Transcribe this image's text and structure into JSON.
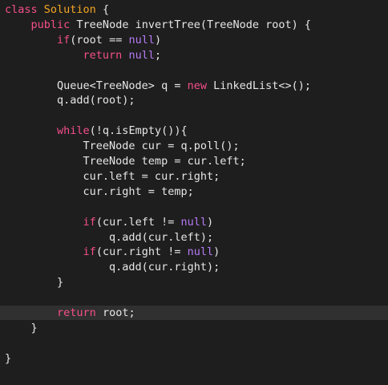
{
  "editor": {
    "colors": {
      "background": "#1e1e1e",
      "current_line": "#303030",
      "keyword": "#f44f8a",
      "class_name": "#f5a623",
      "text": "#e6e6e6",
      "null": "#b57af5"
    },
    "current_line_index": 20,
    "lines": [
      {
        "tokens": [
          {
            "t": "class ",
            "c": "kw"
          },
          {
            "t": "Solution",
            "c": "cls"
          },
          {
            "t": " {",
            "c": "plain"
          }
        ]
      },
      {
        "tokens": [
          {
            "t": "    ",
            "c": "plain"
          },
          {
            "t": "public",
            "c": "kw"
          },
          {
            "t": " TreeNode invertTree(TreeNode root) {",
            "c": "plain"
          }
        ]
      },
      {
        "tokens": [
          {
            "t": "        ",
            "c": "plain"
          },
          {
            "t": "if",
            "c": "kw"
          },
          {
            "t": "(root == ",
            "c": "plain"
          },
          {
            "t": "null",
            "c": "null"
          },
          {
            "t": ")",
            "c": "plain"
          }
        ]
      },
      {
        "tokens": [
          {
            "t": "            ",
            "c": "plain"
          },
          {
            "t": "return",
            "c": "kw"
          },
          {
            "t": " ",
            "c": "plain"
          },
          {
            "t": "null",
            "c": "null"
          },
          {
            "t": ";",
            "c": "plain"
          }
        ]
      },
      {
        "tokens": []
      },
      {
        "tokens": [
          {
            "t": "        Queue<TreeNode> q = ",
            "c": "plain"
          },
          {
            "t": "new",
            "c": "kw"
          },
          {
            "t": " LinkedList<>();",
            "c": "plain"
          }
        ]
      },
      {
        "tokens": [
          {
            "t": "        q.add(root);",
            "c": "plain"
          }
        ]
      },
      {
        "tokens": []
      },
      {
        "tokens": [
          {
            "t": "        ",
            "c": "plain"
          },
          {
            "t": "while",
            "c": "kw"
          },
          {
            "t": "(!q.isEmpty()){",
            "c": "plain"
          }
        ]
      },
      {
        "tokens": [
          {
            "t": "            TreeNode cur = q.poll();",
            "c": "plain"
          }
        ]
      },
      {
        "tokens": [
          {
            "t": "            TreeNode temp = cur.left;",
            "c": "plain"
          }
        ]
      },
      {
        "tokens": [
          {
            "t": "            cur.left = cur.right;",
            "c": "plain"
          }
        ]
      },
      {
        "tokens": [
          {
            "t": "            cur.right = temp;",
            "c": "plain"
          }
        ]
      },
      {
        "tokens": []
      },
      {
        "tokens": [
          {
            "t": "            ",
            "c": "plain"
          },
          {
            "t": "if",
            "c": "kw"
          },
          {
            "t": "(cur.left != ",
            "c": "plain"
          },
          {
            "t": "null",
            "c": "null"
          },
          {
            "t": ")",
            "c": "plain"
          }
        ]
      },
      {
        "tokens": [
          {
            "t": "                q.add(cur.left);",
            "c": "plain"
          }
        ]
      },
      {
        "tokens": [
          {
            "t": "            ",
            "c": "plain"
          },
          {
            "t": "if",
            "c": "kw"
          },
          {
            "t": "(cur.right != ",
            "c": "plain"
          },
          {
            "t": "null",
            "c": "null"
          },
          {
            "t": ")",
            "c": "plain"
          }
        ]
      },
      {
        "tokens": [
          {
            "t": "                q.add(cur.right);",
            "c": "plain"
          }
        ]
      },
      {
        "tokens": [
          {
            "t": "        }",
            "c": "plain"
          }
        ]
      },
      {
        "tokens": []
      },
      {
        "tokens": [
          {
            "t": "        ",
            "c": "plain"
          },
          {
            "t": "return",
            "c": "kw"
          },
          {
            "t": " root;",
            "c": "plain"
          }
        ]
      },
      {
        "tokens": [
          {
            "t": "    }",
            "c": "plain"
          }
        ]
      },
      {
        "tokens": []
      },
      {
        "tokens": [
          {
            "t": "}",
            "c": "plain"
          }
        ]
      }
    ]
  }
}
